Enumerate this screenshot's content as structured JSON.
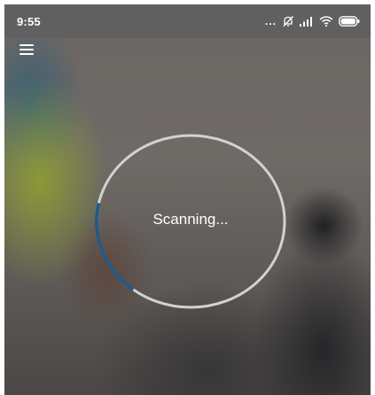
{
  "status_bar": {
    "time": "9:55",
    "more_indicator": "...",
    "icons": [
      "notifications-off-icon",
      "signal-icon",
      "wifi-icon",
      "battery-icon"
    ]
  },
  "app_bar": {
    "menu_icon": "hamburger-menu-icon"
  },
  "scanner": {
    "label": "Scanning...",
    "progress": 0.18
  },
  "colors": {
    "ring": "#d2d2d2",
    "progress_arc": "#1f5a8c",
    "status_bar_bg": "#5f5f5f",
    "text": "#ffffff"
  }
}
